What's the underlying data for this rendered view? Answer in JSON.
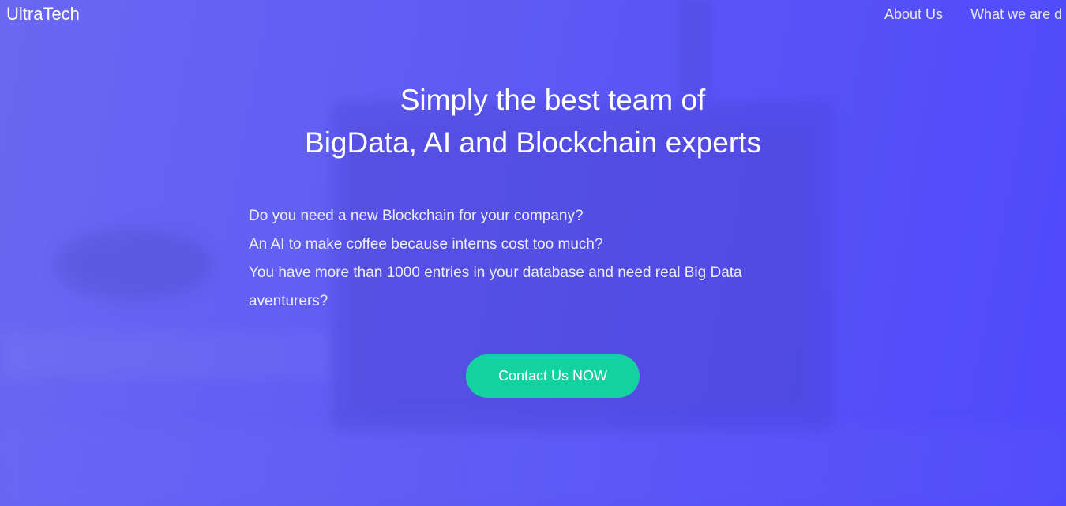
{
  "header": {
    "brand": "UltraTech",
    "nav": [
      {
        "label": "About Us"
      },
      {
        "label": "What we are d"
      }
    ]
  },
  "hero": {
    "headline_line1": "Simply the best team of",
    "headline_line2": "BigData, AI and Blockchain experts",
    "intro_lines": [
      "Do you need a new Blockchain for your company?",
      "An AI to make coffee because interns cost too much?",
      "You have more than 1000 entries in your database and need real Big Data",
      "aventurers?"
    ],
    "cta_label": "Contact Us NOW"
  },
  "colors": {
    "background": "#5a58f5",
    "cta": "#14d1a0",
    "text": "#ffffff"
  }
}
